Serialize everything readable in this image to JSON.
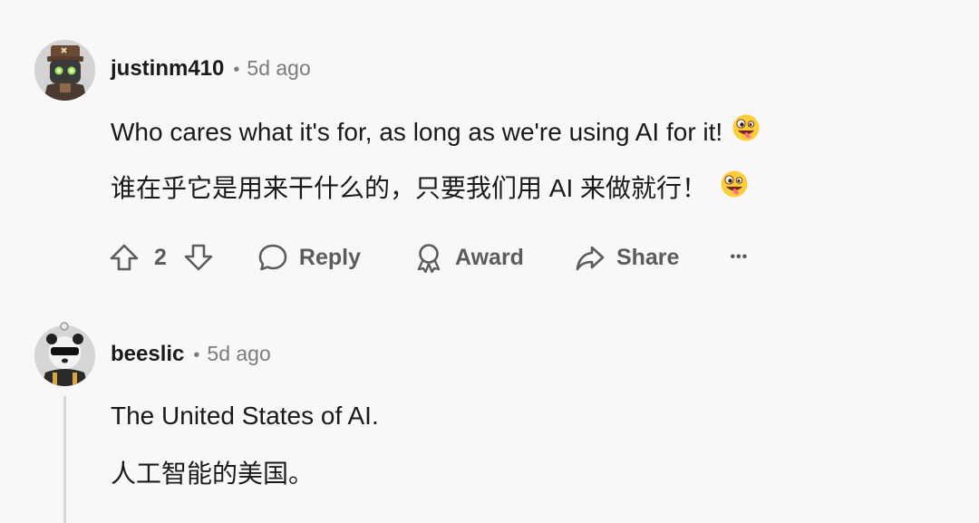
{
  "comments": [
    {
      "username": "justinm410",
      "separator": "•",
      "age": "5d ago",
      "lines": [
        "Who cares what it's for, as long as we're using AI for it!",
        "谁在乎它是用来干什么的，只要我们用 AI 来做就行！"
      ],
      "line_emoji": "zany-face-icon",
      "upvote_count": "2",
      "actions": {
        "reply": "Reply",
        "award": "Award",
        "share": "Share",
        "more": "•••"
      }
    },
    {
      "username": "beeslic",
      "separator": "•",
      "age": "5d ago",
      "lines": [
        "The United States of AI.",
        "人工智能的美国。"
      ]
    }
  ],
  "colors": {
    "background": "#f8f8f8",
    "text": "#1a1a1b",
    "muted": "#7c7c7c",
    "action": "#5c5c5c",
    "thread_line": "#d7d7d7"
  }
}
